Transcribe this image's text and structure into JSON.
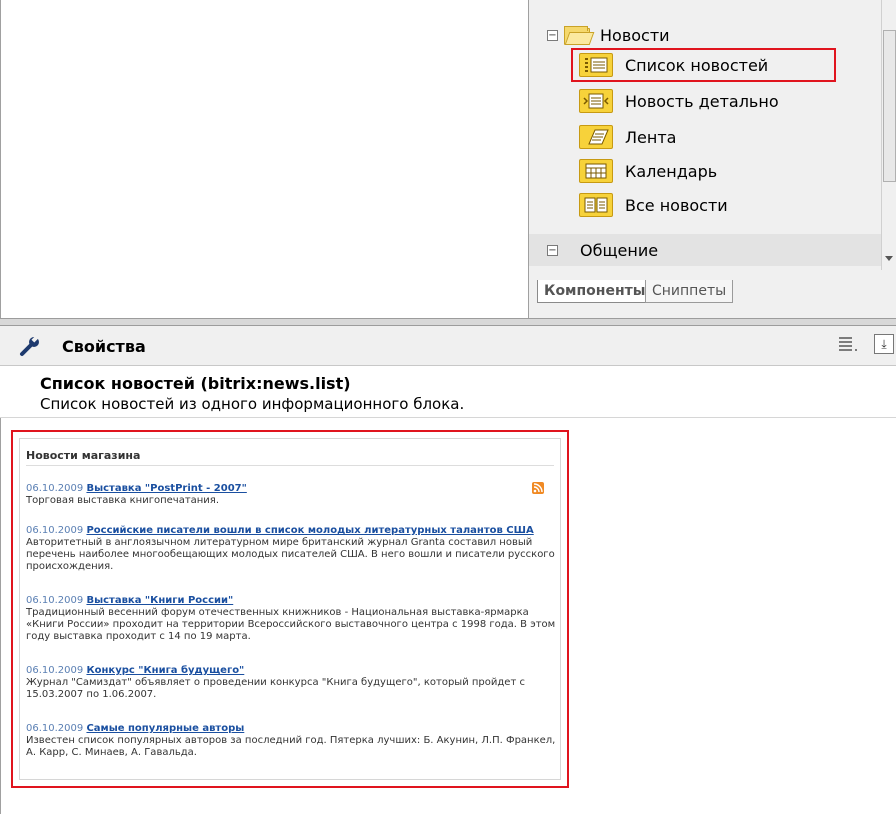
{
  "tree": {
    "group_label": "Новости",
    "items": [
      {
        "label": "Список новостей",
        "icon": "news-list-icon",
        "selected": true
      },
      {
        "label": "Новость детально",
        "icon": "news-detail-icon"
      },
      {
        "label": "Лента",
        "icon": "news-line-icon"
      },
      {
        "label": "Календарь",
        "icon": "calendar-icon"
      },
      {
        "label": "Все новости",
        "icon": "all-news-icon"
      }
    ],
    "next_group_label": "Общение",
    "toggle_expanded": "−",
    "toggle_collapsed": "−"
  },
  "tabs": {
    "components": "Компоненты",
    "snippets": "Сниппеты"
  },
  "properties": {
    "title": "Свойства",
    "download_glyph": "⤓"
  },
  "component": {
    "name": "Список новостей (bitrix:news.list)",
    "description": "Список новостей из одного информационного блока."
  },
  "preview": {
    "title": "Новости магазина",
    "rss_glyph": ")",
    "news": [
      {
        "date": "06.10.2009",
        "title": "Выставка \"PostPrint - 2007\"",
        "text": "Торговая выставка книгопечатания."
      },
      {
        "date": "06.10.2009",
        "title": "Российские писатели вошли в список молодых литературных талантов США",
        "text": "Авторитетный в англоязычном литературном мире британский журнал Granta составил новый перечень наиболее многообещающих молодых писателей США. В него вошли и писатели русского происхождения."
      },
      {
        "date": "06.10.2009",
        "title": "Выставка \"Книги России\"",
        "text": "Традиционный весенний форум отечественных книжников - Национальная выставка-ярмарка «Книги России» проходит на территории Всероссийского выставочного центра с 1998 года. В этом году выставка проходит с 14 по 19 марта."
      },
      {
        "date": "06.10.2009",
        "title": "Конкурс \"Книга будущего\"",
        "text": "Журнал \"Самиздат\" объявляет о проведении конкурса \"Книга будущего\", который пройдет с 15.03.2007 по 1.06.2007."
      },
      {
        "date": "06.10.2009",
        "title": "Самые популярные авторы",
        "text": "Известен список популярных авторов за последний год. Пятерка лучших: Б. Акунин, Л.П. Франкел, А. Карр, С. Минаев, А. Гавальда."
      }
    ]
  }
}
